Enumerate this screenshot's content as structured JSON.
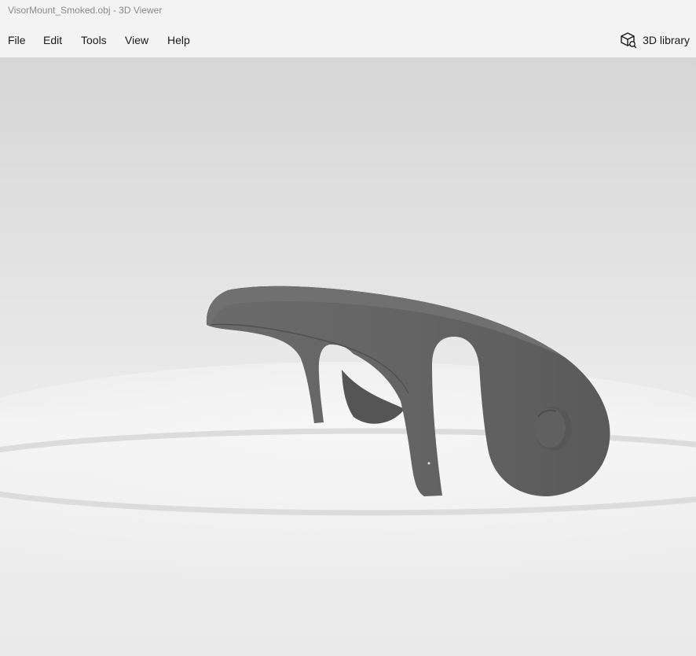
{
  "window": {
    "title": "VisorMount_Smoked.obj - 3D Viewer"
  },
  "menu": {
    "items": [
      {
        "label": "File"
      },
      {
        "label": "Edit"
      },
      {
        "label": "Tools"
      },
      {
        "label": "View"
      },
      {
        "label": "Help"
      }
    ],
    "library_button": {
      "label": "3D library",
      "icon": "3d-cube-icon"
    }
  },
  "viewport": {
    "model": "visor-mount-model",
    "model_color": "#616161",
    "background_top": "#d9d9d9",
    "floor_color": "#f2f2f2"
  }
}
